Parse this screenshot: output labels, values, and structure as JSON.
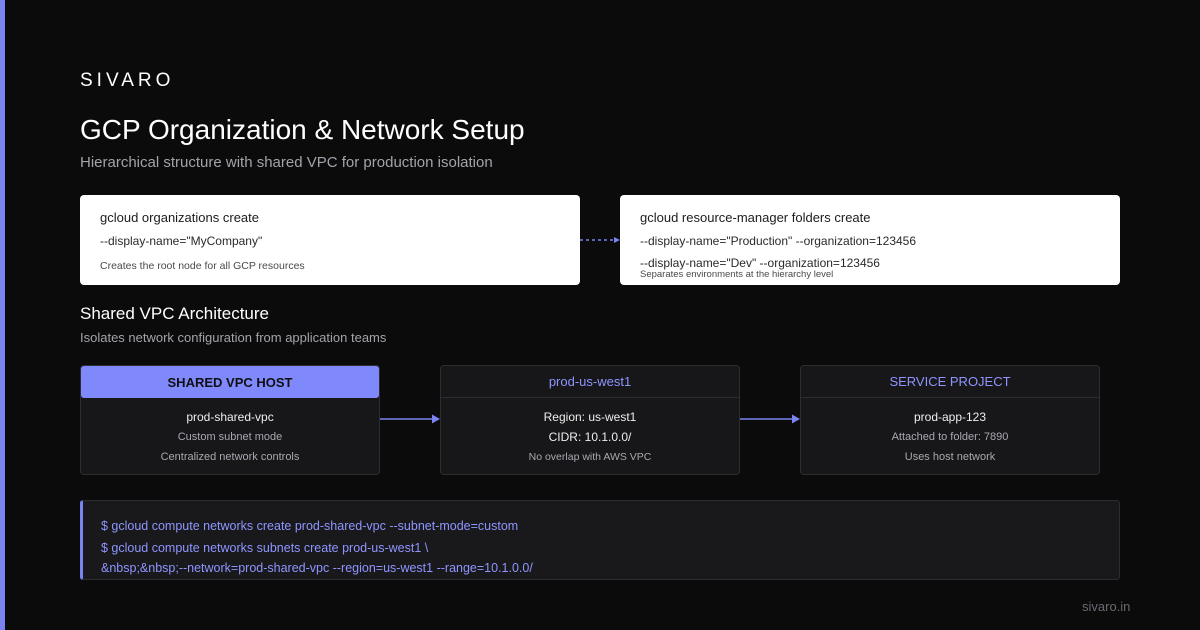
{
  "brand": "SIVARO",
  "title": "GCP Organization & Network Setup",
  "subtitle": "Hierarchical structure with shared VPC for production isolation",
  "org_card": {
    "title": "gcloud organizations create",
    "line1": "--display-name=\"MyCompany\"",
    "note": "Creates the root node for all GCP resources"
  },
  "folder_card": {
    "title": "gcloud resource-manager folders create",
    "line1": "--display-name=\"Production\" --organization=123456",
    "line2": "--display-name=\"Dev\" --organization=123456",
    "note": "Separates environments at the hierarchy level"
  },
  "section": {
    "title": "Shared VPC Architecture",
    "subtitle": "Isolates network configuration from application teams"
  },
  "vpc_boxes": [
    {
      "header": "SHARED VPC HOST",
      "line1": "prod-shared-vpc",
      "line2": "Custom subnet mode",
      "line3": "Centralized network controls"
    },
    {
      "header": "prod-us-west1",
      "line1": "Region: us-west1",
      "line2": "CIDR: 10.1.0.0/",
      "line3": "No overlap with AWS VPC"
    },
    {
      "header": "SERVICE PROJECT",
      "line1": "prod-app-123",
      "line2": "Attached to folder: 7890",
      "line3": "Uses host network"
    }
  ],
  "terminal": {
    "lines": [
      "$ gcloud compute networks create prod-shared-vpc --subnet-mode=custom",
      "$ gcloud compute networks subnets create prod-us-west1 \\",
      "&nbsp;&nbsp;--network=prod-shared-vpc --region=us-west1 --range=10.1.0.0/"
    ]
  },
  "footer": "sivaro.in",
  "colors": {
    "accent": "#7b83f0",
    "background": "#0b0b0b",
    "card": "#ffffff",
    "panel": "#17171a"
  }
}
